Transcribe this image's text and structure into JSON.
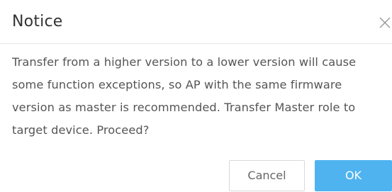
{
  "dialog": {
    "title": "Notice",
    "close_icon": "close-icon",
    "message_lines": [
      "Transfer from a higher version to a lower version will cause",
      "some function exceptions, so AP with the same firmware",
      "version as master is recommended. Transfer Master role to",
      "target device. Proceed?"
    ],
    "cancel_label": "Cancel",
    "ok_label": "OK"
  },
  "colors": {
    "primary": "#4fb3f0",
    "text": "#555555",
    "title": "#333333",
    "border": "#d9d9d9"
  }
}
